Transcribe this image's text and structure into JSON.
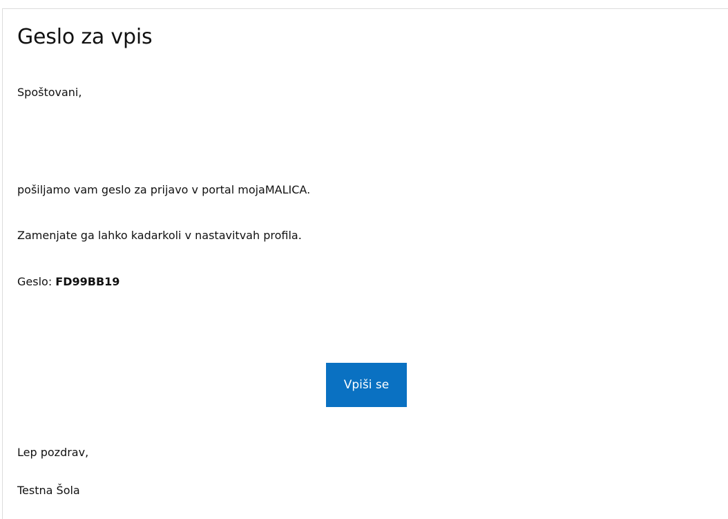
{
  "email": {
    "title": "Geslo za vpis",
    "greeting": "Spoštovani,",
    "paragraphs": [
      "pošiljamo vam geslo za prijavo v portal mojaMALICA.",
      "Zamenjate ga lahko kadarkoli v nastavitvah profila."
    ],
    "password_label": "Geslo:",
    "password_value": "FD99BB19",
    "button_label": "Vpiši se",
    "closing": "Lep pozdrav,",
    "signature": "Testna Šola"
  },
  "colors": {
    "button_background": "#0a71c2",
    "button_text": "#ffffff",
    "text": "#111111",
    "border": "#dcdcdc"
  }
}
